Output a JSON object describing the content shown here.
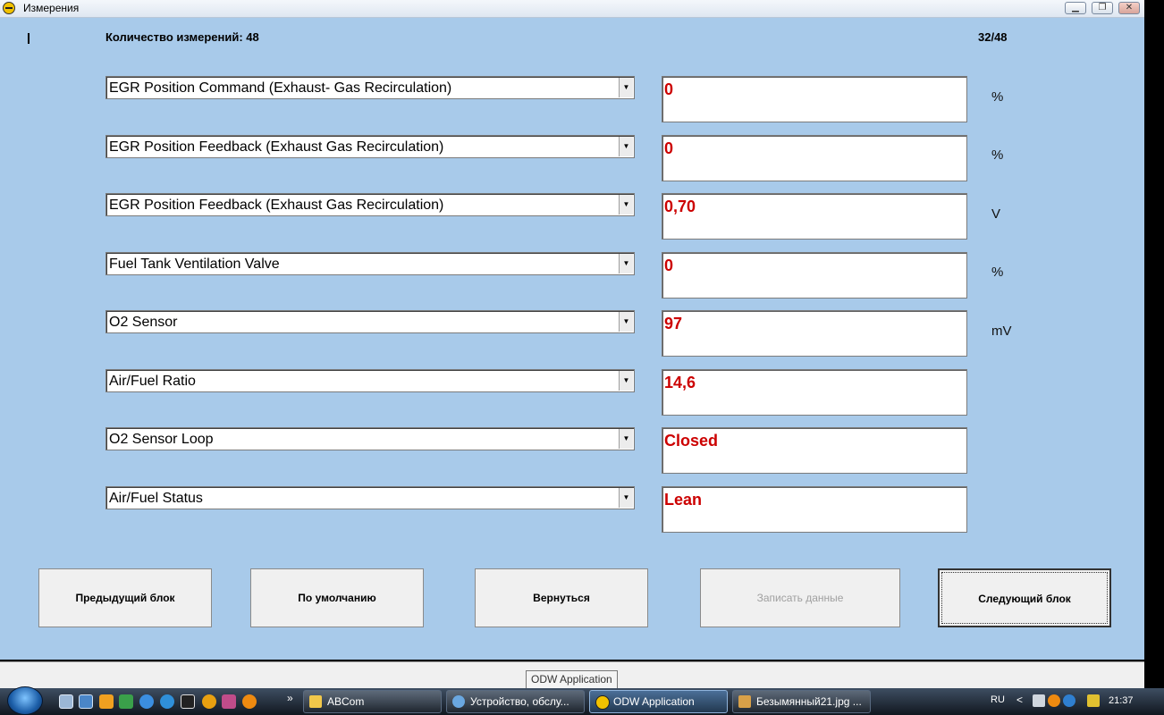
{
  "window": {
    "title": "Измерения",
    "buttons": {
      "minimize": "▁",
      "restore": "❐",
      "close": "✕"
    }
  },
  "header": {
    "count_label": "Количество измерений: 48",
    "page_counter": "32/48"
  },
  "measurements": [
    {
      "name": "EGR Position Command (Exhaust- Gas Recirculation)",
      "value": "0",
      "unit": "%"
    },
    {
      "name": "EGR Position Feedback (Exhaust Gas Recirculation)",
      "value": "0",
      "unit": "%"
    },
    {
      "name": "EGR Position Feedback (Exhaust Gas Recirculation)",
      "value": "0,70",
      "unit": "V"
    },
    {
      "name": "Fuel Tank Ventilation Valve",
      "value": "0",
      "unit": "%"
    },
    {
      "name": "O2 Sensor",
      "value": "97",
      "unit": "mV"
    },
    {
      "name": "Air/Fuel Ratio",
      "value": "14,6",
      "unit": ""
    },
    {
      "name": "O2 Sensor Loop",
      "value": "Closed",
      "unit": ""
    },
    {
      "name": "Air/Fuel Status",
      "value": "Lean",
      "unit": ""
    }
  ],
  "buttons": {
    "prev": "Предыдущий блок",
    "default": "По умолчанию",
    "back": "Вернуться",
    "record": "Записать данные",
    "next": "Следующий блок"
  },
  "tooltip": "ODW Application",
  "taskbar": {
    "quicklaunch_more": "»",
    "tasks": [
      {
        "label": "ABCom"
      },
      {
        "label": "Устройство, обслу..."
      },
      {
        "label": "ODW Application"
      },
      {
        "label": "Безымянный21.jpg ..."
      }
    ],
    "lang": "RU",
    "tray_arrow": "<",
    "clock": "21:37"
  },
  "colors": {
    "client_bg": "#a8caea",
    "value_red": "#cc0000"
  }
}
